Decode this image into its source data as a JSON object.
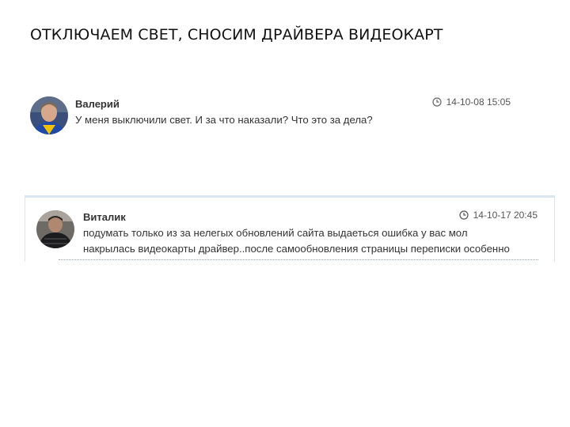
{
  "title": "ОТКЛЮЧАЕМ СВЕТ, СНОСИМ ДРАЙВЕРА ВИДЕОКАРТ",
  "comments": [
    {
      "author": "Валерий",
      "date": "14-10-08 15:05",
      "lines": [
        "У меня выключили свет. И за что наказали? Что это за дела?"
      ],
      "icon": "clock-icon"
    },
    {
      "author": "Виталик",
      "date": "14-10-17 20:45",
      "lines": [
        "подумать только из за нелегых обновлений сайта выдаеться ошибка у вас мол",
        "накрылась видеокарты драйвер..после самообновления страницы переписки особенно"
      ],
      "icon": "clock-icon"
    }
  ],
  "colors": {
    "highlight_border": "#dbe6f3",
    "text": "#333333"
  }
}
